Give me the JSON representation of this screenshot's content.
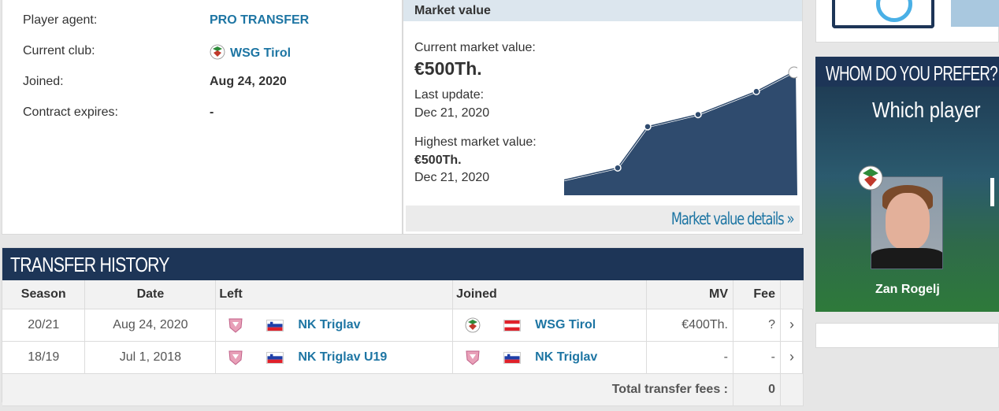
{
  "player_info": {
    "rows": [
      {
        "label": "Player agent:",
        "value": "PRO TRANSFER",
        "is_link": true
      },
      {
        "label": "Current club:",
        "value": "WSG Tirol",
        "is_link": true
      },
      {
        "label": "Joined:",
        "value": "Aug 24, 2020",
        "is_link": false
      },
      {
        "label": "Contract expires:",
        "value": "-",
        "is_link": false
      }
    ]
  },
  "market_value": {
    "header": "Market value",
    "current_label": "Current market value:",
    "current_value": "€500Th.",
    "last_update_label": "Last update:",
    "last_update_value": "Dec 21, 2020",
    "highest_label": "Highest market value:",
    "highest_value": "€500Th.",
    "highest_date": "Dec 21, 2020",
    "details_link": "Market value details »"
  },
  "chart_data": {
    "type": "area",
    "values": [
      0.1,
      0.2,
      0.54,
      0.64,
      0.83,
      1.0
    ]
  },
  "transfer_history": {
    "title": "TRANSFER HISTORY",
    "columns": [
      "Season",
      "Date",
      "Left",
      "Joined",
      "MV",
      "Fee"
    ],
    "rows": [
      {
        "season": "20/21",
        "date": "Aug 24, 2020",
        "left_club": "NK Triglav",
        "joined_club": "WSG Tirol",
        "mv": "€400Th.",
        "fee": "?"
      },
      {
        "season": "18/19",
        "date": "Jul 1, 2018",
        "left_club": "NK Triglav U19",
        "joined_club": "NK Triglav",
        "mv": "-",
        "fee": "-"
      }
    ],
    "total_label": "Total transfer fees :",
    "total_value": "0"
  },
  "poll": {
    "title": "WHOM DO YOU PREFER?",
    "question": "Which player",
    "player_name": "Zan Rogelj"
  },
  "colors": {
    "navy": "#1d3557",
    "link_blue": "#1d75a3",
    "mv_header_bg": "#dce6ee"
  }
}
